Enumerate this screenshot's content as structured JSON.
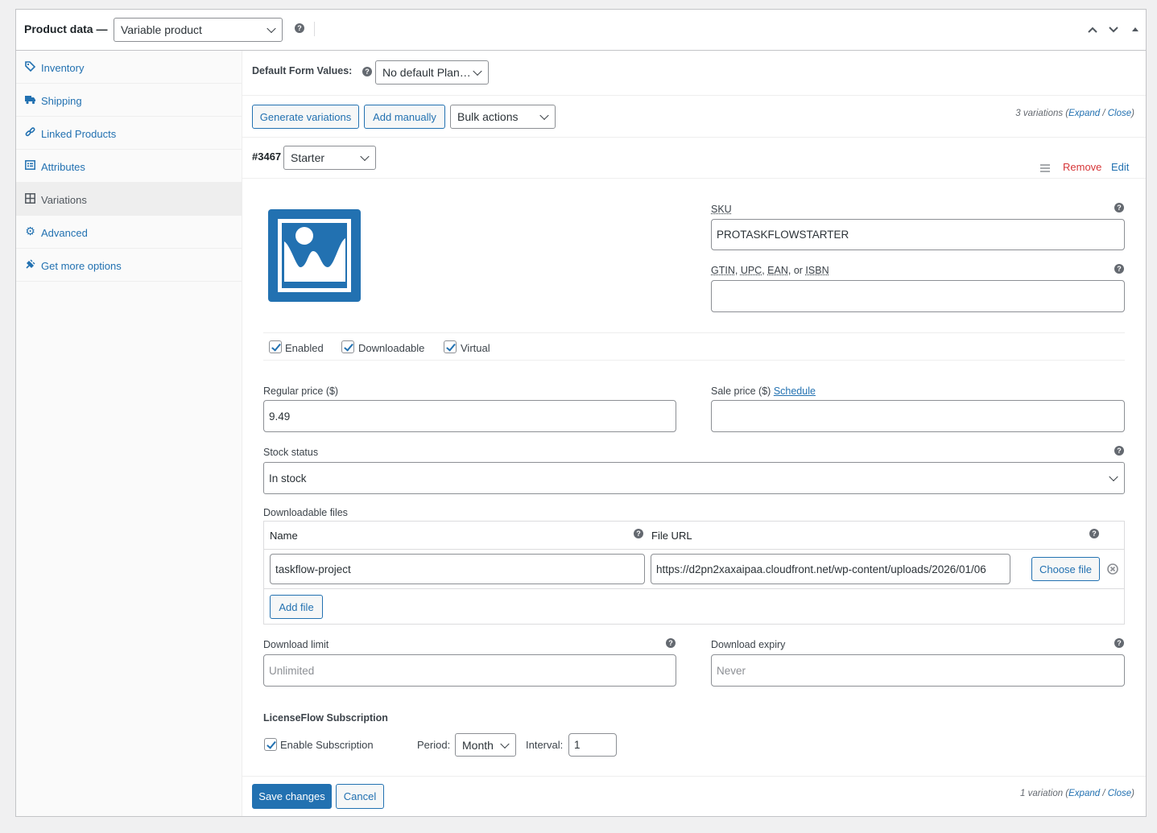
{
  "header": {
    "title": "Product data —",
    "product_type": "Variable product"
  },
  "sidebar": {
    "items": [
      {
        "label": "Inventory",
        "icon": "tag-icon"
      },
      {
        "label": "Shipping",
        "icon": "truck-icon"
      },
      {
        "label": "Linked Products",
        "icon": "link-icon"
      },
      {
        "label": "Attributes",
        "icon": "list-icon"
      },
      {
        "label": "Variations",
        "icon": "grid-icon",
        "active": true
      },
      {
        "label": "Advanced",
        "icon": "gear-icon"
      },
      {
        "label": "Get more options",
        "icon": "plugin-icon"
      }
    ]
  },
  "defaults": {
    "label": "Default Form Values:",
    "value": "No default Plan…"
  },
  "toolbar": {
    "generate": "Generate variations",
    "add_manually": "Add manually",
    "bulk_actions": "Bulk actions",
    "count_prefix": "3 variations (",
    "expand": "Expand",
    "slash": " / ",
    "close": "Close",
    "count_suffix": ")"
  },
  "variation": {
    "id": "#3467",
    "plan": "Starter",
    "remove": "Remove",
    "edit": "Edit",
    "sku_label": "SKU",
    "sku_value": "PROTASKFLOWSTARTER",
    "gtin_label_parts": [
      "GTIN",
      ", ",
      "UPC",
      ", ",
      "EAN",
      ", or ",
      "ISBN"
    ],
    "gtin_value": "",
    "enabled": "Enabled",
    "downloadable": "Downloadable",
    "virtual": "Virtual",
    "regular_price_label": "Regular price ($)",
    "regular_price": "9.49",
    "sale_price_label": "Sale price ($) ",
    "schedule": "Schedule",
    "sale_price": "",
    "stock_status_label": "Stock status",
    "stock_status": "In stock",
    "downloadable_files_label": "Downloadable files",
    "files_name_header": "Name",
    "files_url_header": "File URL",
    "file_name": "taskflow-project",
    "file_url": "https://d2pn2xaxaipaa.cloudfront.net/wp-content/uploads/2026/01/06",
    "choose_file": "Choose file",
    "add_file": "Add file",
    "download_limit_label": "Download limit",
    "download_limit_placeholder": "Unlimited",
    "download_expiry_label": "Download expiry",
    "download_expiry_placeholder": "Never",
    "subscription_title": "LicenseFlow Subscription",
    "enable_subscription": "Enable Subscription",
    "period_label": "Period:",
    "period_value": "Month",
    "interval_label": "Interval:",
    "interval_value": "1"
  },
  "footer": {
    "save": "Save changes",
    "cancel": "Cancel",
    "count_prefix": "1 variation (",
    "expand": "Expand",
    "slash": " / ",
    "close": "Close",
    "count_suffix": ")"
  },
  "colors": {
    "accent": "#2271b1",
    "remove": "#d63638"
  }
}
